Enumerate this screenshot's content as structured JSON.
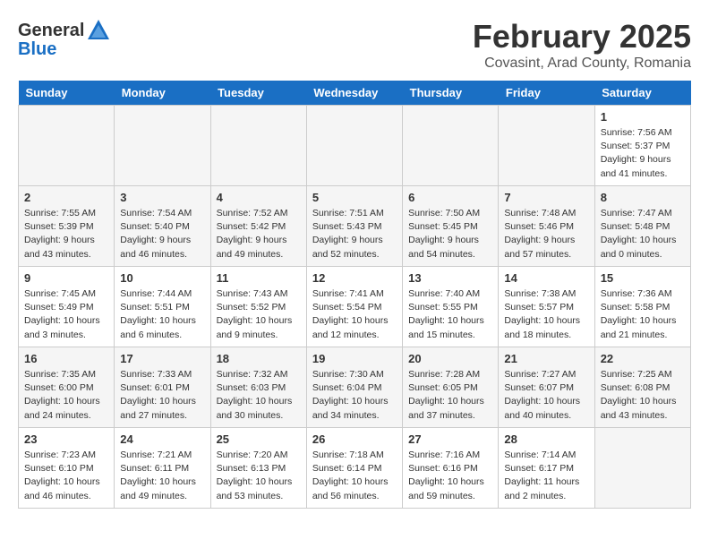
{
  "header": {
    "logo_general": "General",
    "logo_blue": "Blue",
    "title": "February 2025",
    "subtitle": "Covasint, Arad County, Romania"
  },
  "calendar": {
    "days_of_week": [
      "Sunday",
      "Monday",
      "Tuesday",
      "Wednesday",
      "Thursday",
      "Friday",
      "Saturday"
    ],
    "weeks": [
      [
        {
          "day": "",
          "info": "",
          "empty": true
        },
        {
          "day": "",
          "info": "",
          "empty": true
        },
        {
          "day": "",
          "info": "",
          "empty": true
        },
        {
          "day": "",
          "info": "",
          "empty": true
        },
        {
          "day": "",
          "info": "",
          "empty": true
        },
        {
          "day": "",
          "info": "",
          "empty": true
        },
        {
          "day": "1",
          "info": "Sunrise: 7:56 AM\nSunset: 5:37 PM\nDaylight: 9 hours and 41 minutes."
        }
      ],
      [
        {
          "day": "2",
          "info": "Sunrise: 7:55 AM\nSunset: 5:39 PM\nDaylight: 9 hours and 43 minutes."
        },
        {
          "day": "3",
          "info": "Sunrise: 7:54 AM\nSunset: 5:40 PM\nDaylight: 9 hours and 46 minutes."
        },
        {
          "day": "4",
          "info": "Sunrise: 7:52 AM\nSunset: 5:42 PM\nDaylight: 9 hours and 49 minutes."
        },
        {
          "day": "5",
          "info": "Sunrise: 7:51 AM\nSunset: 5:43 PM\nDaylight: 9 hours and 52 minutes."
        },
        {
          "day": "6",
          "info": "Sunrise: 7:50 AM\nSunset: 5:45 PM\nDaylight: 9 hours and 54 minutes."
        },
        {
          "day": "7",
          "info": "Sunrise: 7:48 AM\nSunset: 5:46 PM\nDaylight: 9 hours and 57 minutes."
        },
        {
          "day": "8",
          "info": "Sunrise: 7:47 AM\nSunset: 5:48 PM\nDaylight: 10 hours and 0 minutes."
        }
      ],
      [
        {
          "day": "9",
          "info": "Sunrise: 7:45 AM\nSunset: 5:49 PM\nDaylight: 10 hours and 3 minutes."
        },
        {
          "day": "10",
          "info": "Sunrise: 7:44 AM\nSunset: 5:51 PM\nDaylight: 10 hours and 6 minutes."
        },
        {
          "day": "11",
          "info": "Sunrise: 7:43 AM\nSunset: 5:52 PM\nDaylight: 10 hours and 9 minutes."
        },
        {
          "day": "12",
          "info": "Sunrise: 7:41 AM\nSunset: 5:54 PM\nDaylight: 10 hours and 12 minutes."
        },
        {
          "day": "13",
          "info": "Sunrise: 7:40 AM\nSunset: 5:55 PM\nDaylight: 10 hours and 15 minutes."
        },
        {
          "day": "14",
          "info": "Sunrise: 7:38 AM\nSunset: 5:57 PM\nDaylight: 10 hours and 18 minutes."
        },
        {
          "day": "15",
          "info": "Sunrise: 7:36 AM\nSunset: 5:58 PM\nDaylight: 10 hours and 21 minutes."
        }
      ],
      [
        {
          "day": "16",
          "info": "Sunrise: 7:35 AM\nSunset: 6:00 PM\nDaylight: 10 hours and 24 minutes."
        },
        {
          "day": "17",
          "info": "Sunrise: 7:33 AM\nSunset: 6:01 PM\nDaylight: 10 hours and 27 minutes."
        },
        {
          "day": "18",
          "info": "Sunrise: 7:32 AM\nSunset: 6:03 PM\nDaylight: 10 hours and 30 minutes."
        },
        {
          "day": "19",
          "info": "Sunrise: 7:30 AM\nSunset: 6:04 PM\nDaylight: 10 hours and 34 minutes."
        },
        {
          "day": "20",
          "info": "Sunrise: 7:28 AM\nSunset: 6:05 PM\nDaylight: 10 hours and 37 minutes."
        },
        {
          "day": "21",
          "info": "Sunrise: 7:27 AM\nSunset: 6:07 PM\nDaylight: 10 hours and 40 minutes."
        },
        {
          "day": "22",
          "info": "Sunrise: 7:25 AM\nSunset: 6:08 PM\nDaylight: 10 hours and 43 minutes."
        }
      ],
      [
        {
          "day": "23",
          "info": "Sunrise: 7:23 AM\nSunset: 6:10 PM\nDaylight: 10 hours and 46 minutes."
        },
        {
          "day": "24",
          "info": "Sunrise: 7:21 AM\nSunset: 6:11 PM\nDaylight: 10 hours and 49 minutes."
        },
        {
          "day": "25",
          "info": "Sunrise: 7:20 AM\nSunset: 6:13 PM\nDaylight: 10 hours and 53 minutes."
        },
        {
          "day": "26",
          "info": "Sunrise: 7:18 AM\nSunset: 6:14 PM\nDaylight: 10 hours and 56 minutes."
        },
        {
          "day": "27",
          "info": "Sunrise: 7:16 AM\nSunset: 6:16 PM\nDaylight: 10 hours and 59 minutes."
        },
        {
          "day": "28",
          "info": "Sunrise: 7:14 AM\nSunset: 6:17 PM\nDaylight: 11 hours and 2 minutes."
        },
        {
          "day": "",
          "info": "",
          "empty": true
        }
      ]
    ]
  }
}
